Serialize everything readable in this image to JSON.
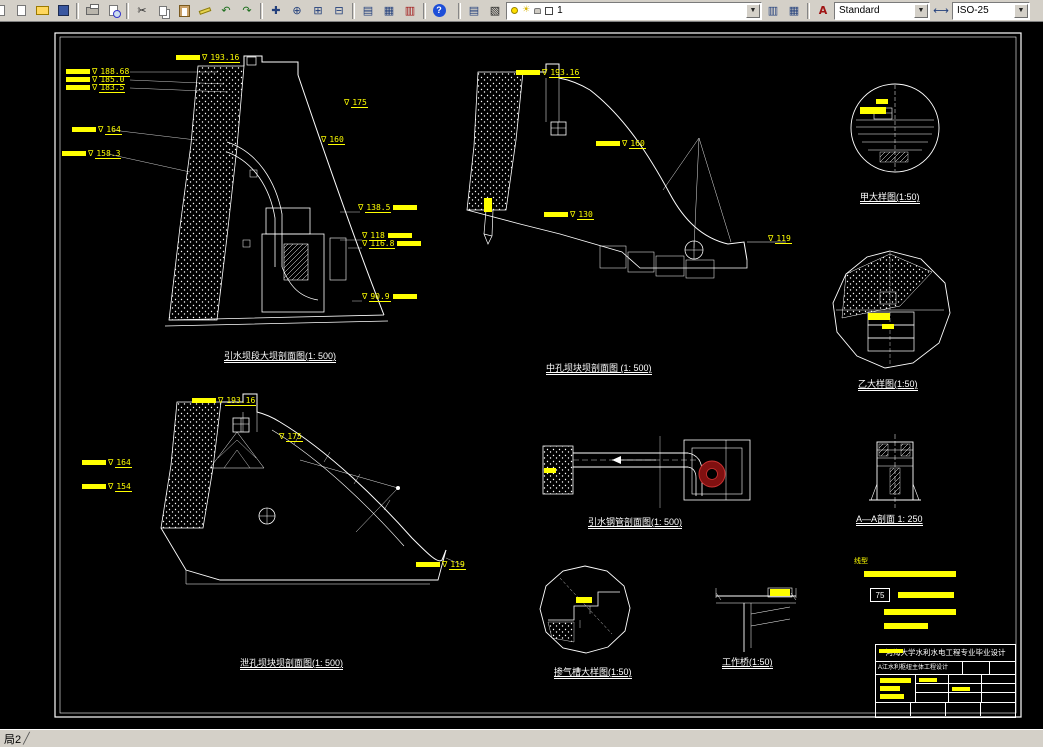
{
  "toolbar": {
    "text_style": "Standard",
    "dim_style": "ISO-25",
    "layer_name": "1"
  },
  "statusbar": {
    "layout_tab": "局2"
  },
  "colors": {
    "highlight": "#ffff00",
    "line": "#ffffff",
    "background": "#000000",
    "chrome": "#d4d0c8",
    "steel_section": "#801010"
  },
  "captions": {
    "d1": "引水坝段大坝剖面图(1: 500)",
    "d2": "中孔坝块坝剖面图 (1: 500)",
    "d3": "甲大样图(1:50)",
    "d4": "乙大样图(1:50)",
    "d5": "泄孔坝块坝剖面图(1: 500)",
    "d6": "引水钢管剖面图(1: 500)",
    "d7": "掺气槽大样图(1:50)",
    "d8": "工作桥(1:50)",
    "d9": "A—A剖面 1: 250"
  },
  "elevations": {
    "d1": {
      "top": "193.16",
      "l1": "188.68",
      "l2": "185.0",
      "l3": "183.5",
      "l4": "164",
      "l5": "158.3",
      "r1": "175",
      "r2": "160",
      "r3": "138.5",
      "r4": "118",
      "r5": "116.8",
      "r6": "90.9"
    },
    "d2": {
      "top": "193.16",
      "r1": "160",
      "l1": "130",
      "r2": "119"
    },
    "d5": {
      "top": "193.16",
      "r1": "175",
      "l1": "164",
      "l2": "154",
      "r2": "119"
    }
  },
  "legend": {
    "title": "线型",
    "item_75": "75"
  },
  "titleblock": {
    "line1": "河海大学水利水电工程专业毕业设计",
    "line2": "A江水利枢纽主体工程设计"
  }
}
